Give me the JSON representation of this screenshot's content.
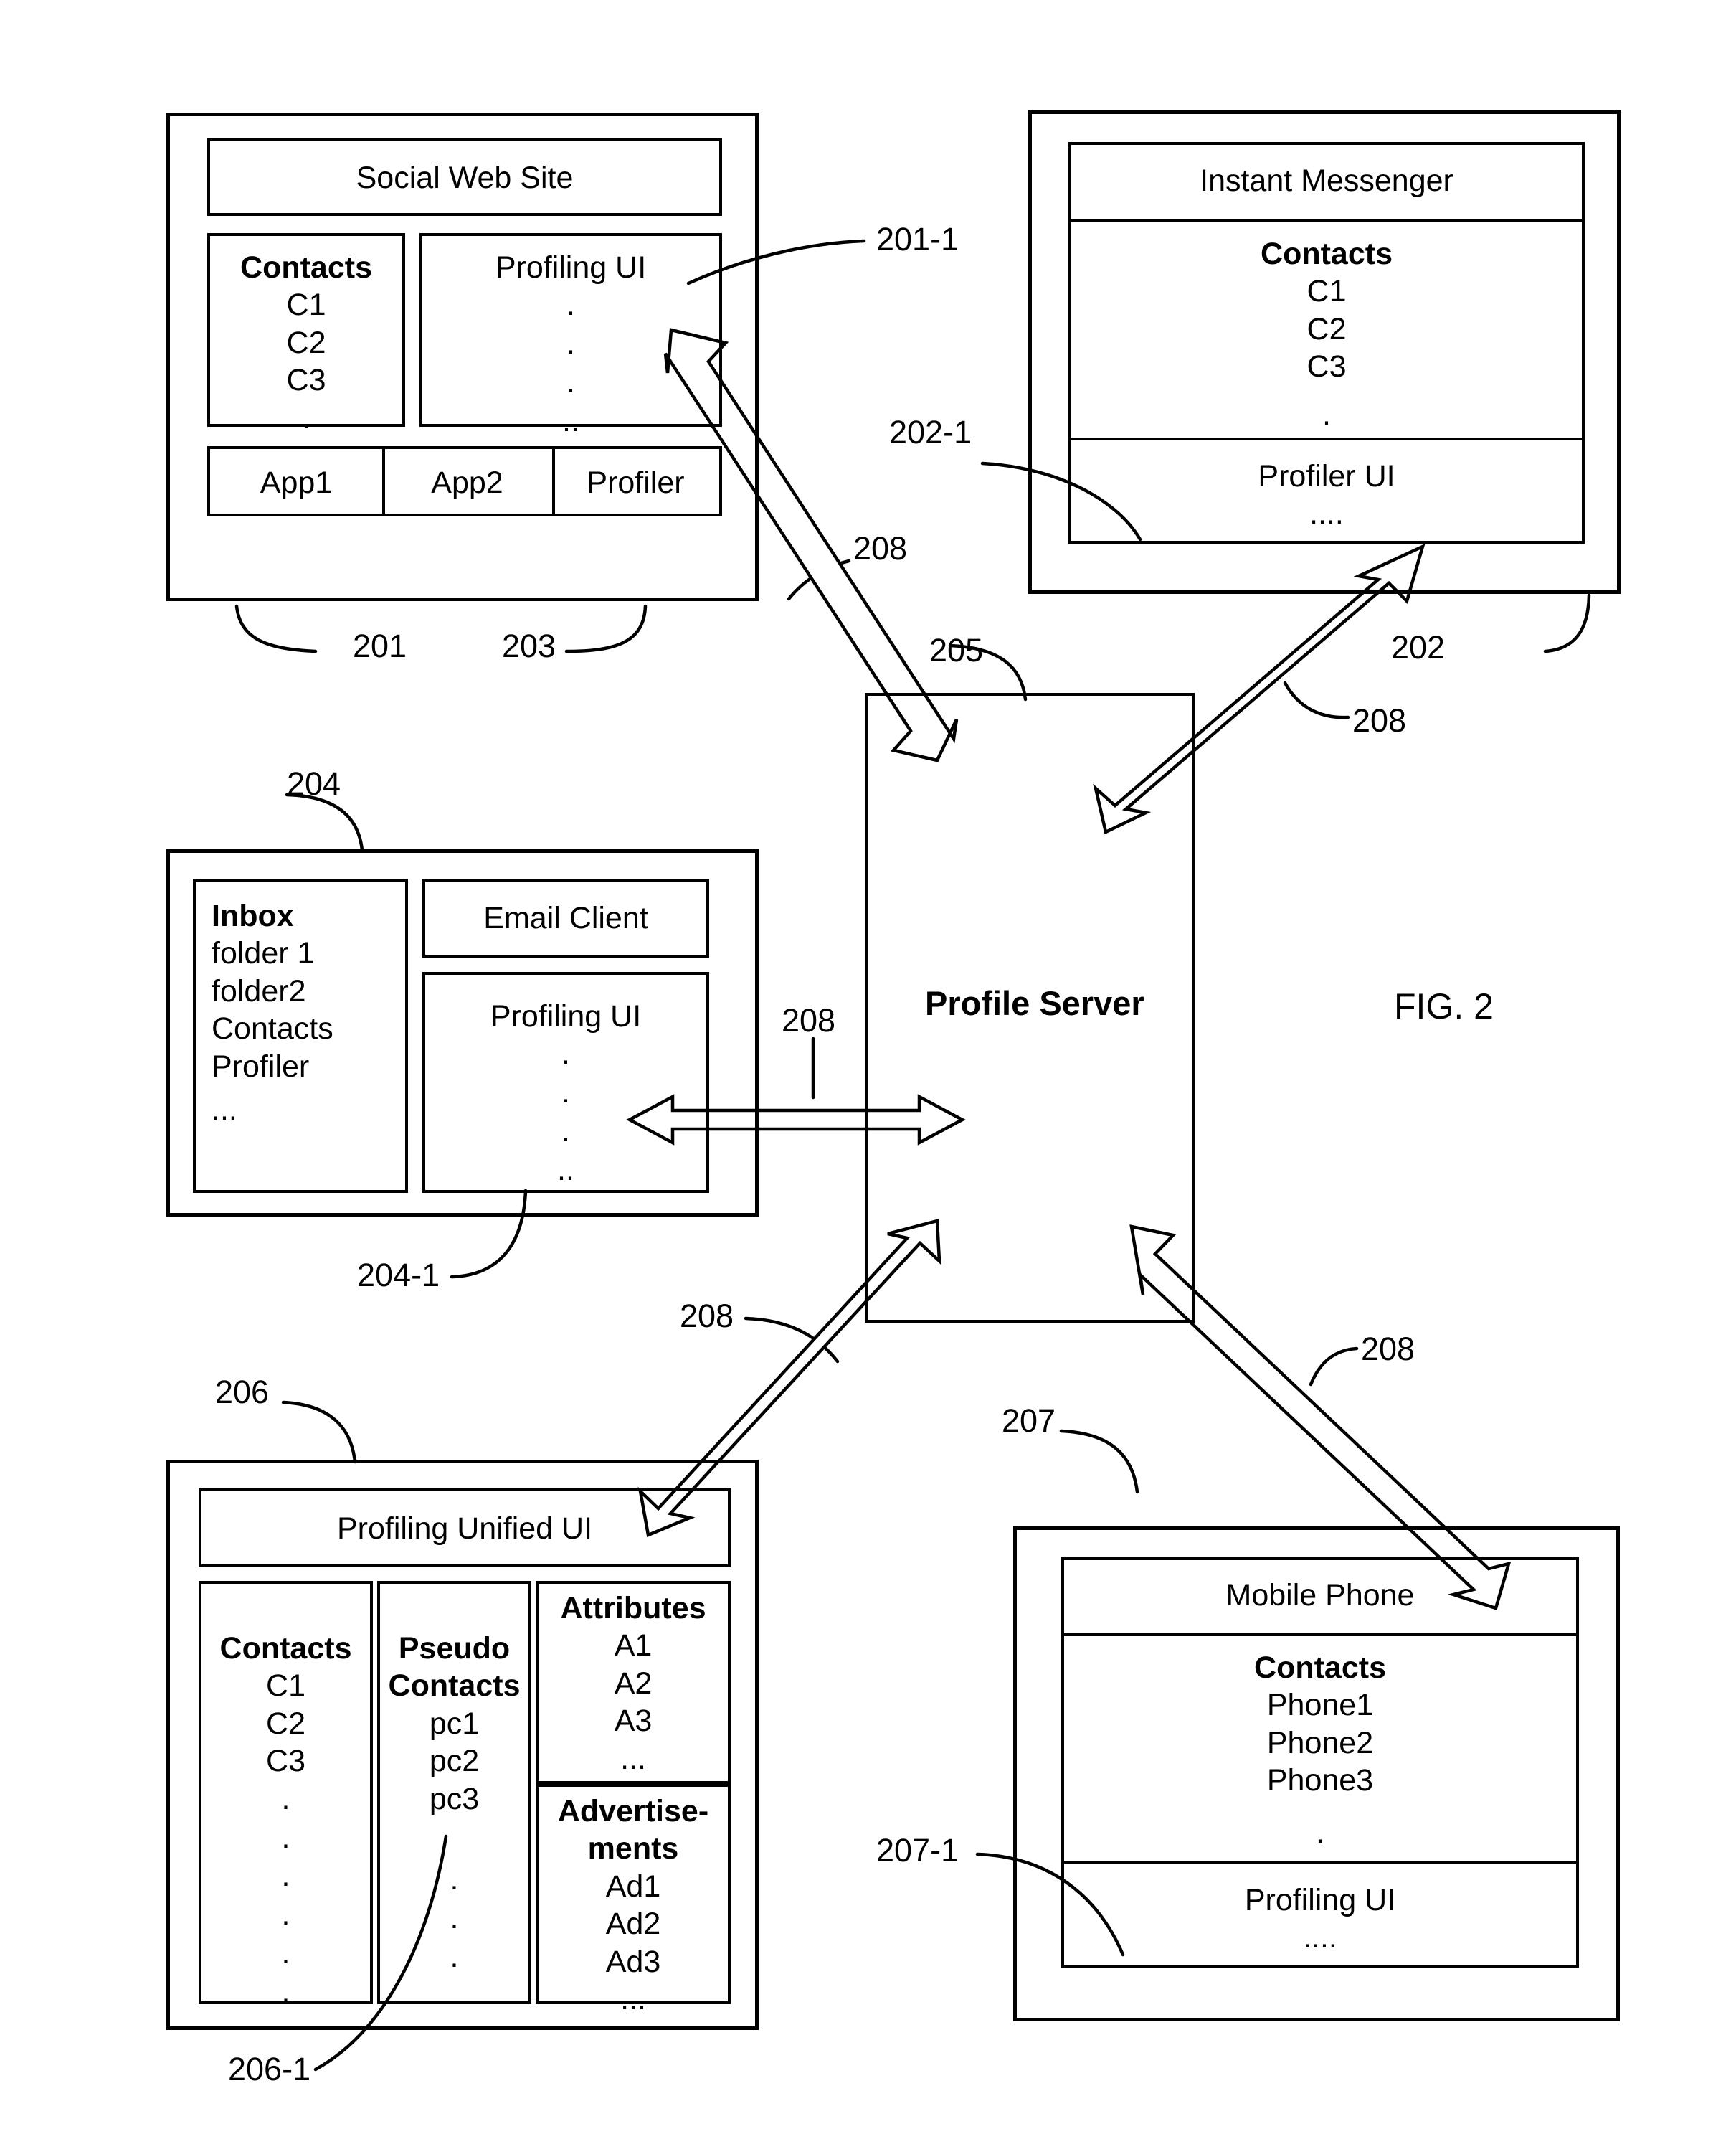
{
  "figure": {
    "caption": "FIG. 2"
  },
  "nodes": {
    "social_web_site": {
      "ref": "201",
      "profiler_ref": "203",
      "ui_ref": "201-1",
      "title": "Social Web Site",
      "contacts_heading": "Contacts",
      "contacts": [
        "C1",
        "C2",
        "C3"
      ],
      "contacts_more": ".",
      "profiling_ui_title": "Profiling UI",
      "profiling_ui_dots": [
        ".",
        ".",
        ".",
        ".."
      ],
      "apps": [
        "App1",
        "App2",
        "Profiler"
      ]
    },
    "instant_messenger": {
      "ref": "202",
      "ui_ref": "202-1",
      "title": "Instant Messenger",
      "contacts_heading": "Contacts",
      "contacts": [
        "C1",
        "C2",
        "C3"
      ],
      "contacts_more": ".",
      "profiler_ui_title": "Profiler UI",
      "profiler_ui_dots": "...."
    },
    "email_client": {
      "ref": "204",
      "ui_ref": "204-1",
      "title": "Email Client",
      "inbox_heading": "Inbox",
      "inbox_items": [
        "folder 1",
        "folder2",
        "Contacts",
        "Profiler"
      ],
      "inbox_more": "...",
      "profiling_ui_title": "Profiling UI",
      "profiling_ui_dots": [
        ".",
        ".",
        ".",
        ".."
      ]
    },
    "profiling_unified_ui": {
      "ref": "206",
      "ui_ref": "206-1",
      "title": "Profiling Unified UI",
      "contacts_heading": "Contacts",
      "contacts": [
        "C1",
        "C2",
        "C3"
      ],
      "contacts_dots": [
        ".",
        ".",
        ".",
        ".",
        ".",
        "."
      ],
      "pseudo_contacts_heading_line1": "Pseudo",
      "pseudo_contacts_heading_line2": "Contacts",
      "pseudo_contacts": [
        "pc1",
        "pc2",
        "pc3"
      ],
      "pseudo_contacts_dots": [
        ".",
        ".",
        "."
      ],
      "attributes_heading": "Attributes",
      "attributes": [
        "A1",
        "A2",
        "A3"
      ],
      "attributes_more": "...",
      "advertisements_heading_line1": "Advertise-",
      "advertisements_heading_line2": "ments",
      "advertisements": [
        "Ad1",
        "Ad2",
        "Ad3"
      ],
      "advertisements_more": "..."
    },
    "mobile_phone": {
      "ref": "207",
      "ui_ref": "207-1",
      "title": "Mobile Phone",
      "contacts_heading": "Contacts",
      "contacts": [
        "Phone1",
        "Phone2",
        "Phone3"
      ],
      "contacts_more": ".",
      "profiling_ui_title": "Profiling UI",
      "profiling_ui_dots": "...."
    },
    "profile_server": {
      "ref": "205",
      "title": "Profile Server"
    }
  },
  "connections": {
    "label": "208",
    "labels": [
      "208",
      "208",
      "208",
      "208",
      "208"
    ]
  }
}
